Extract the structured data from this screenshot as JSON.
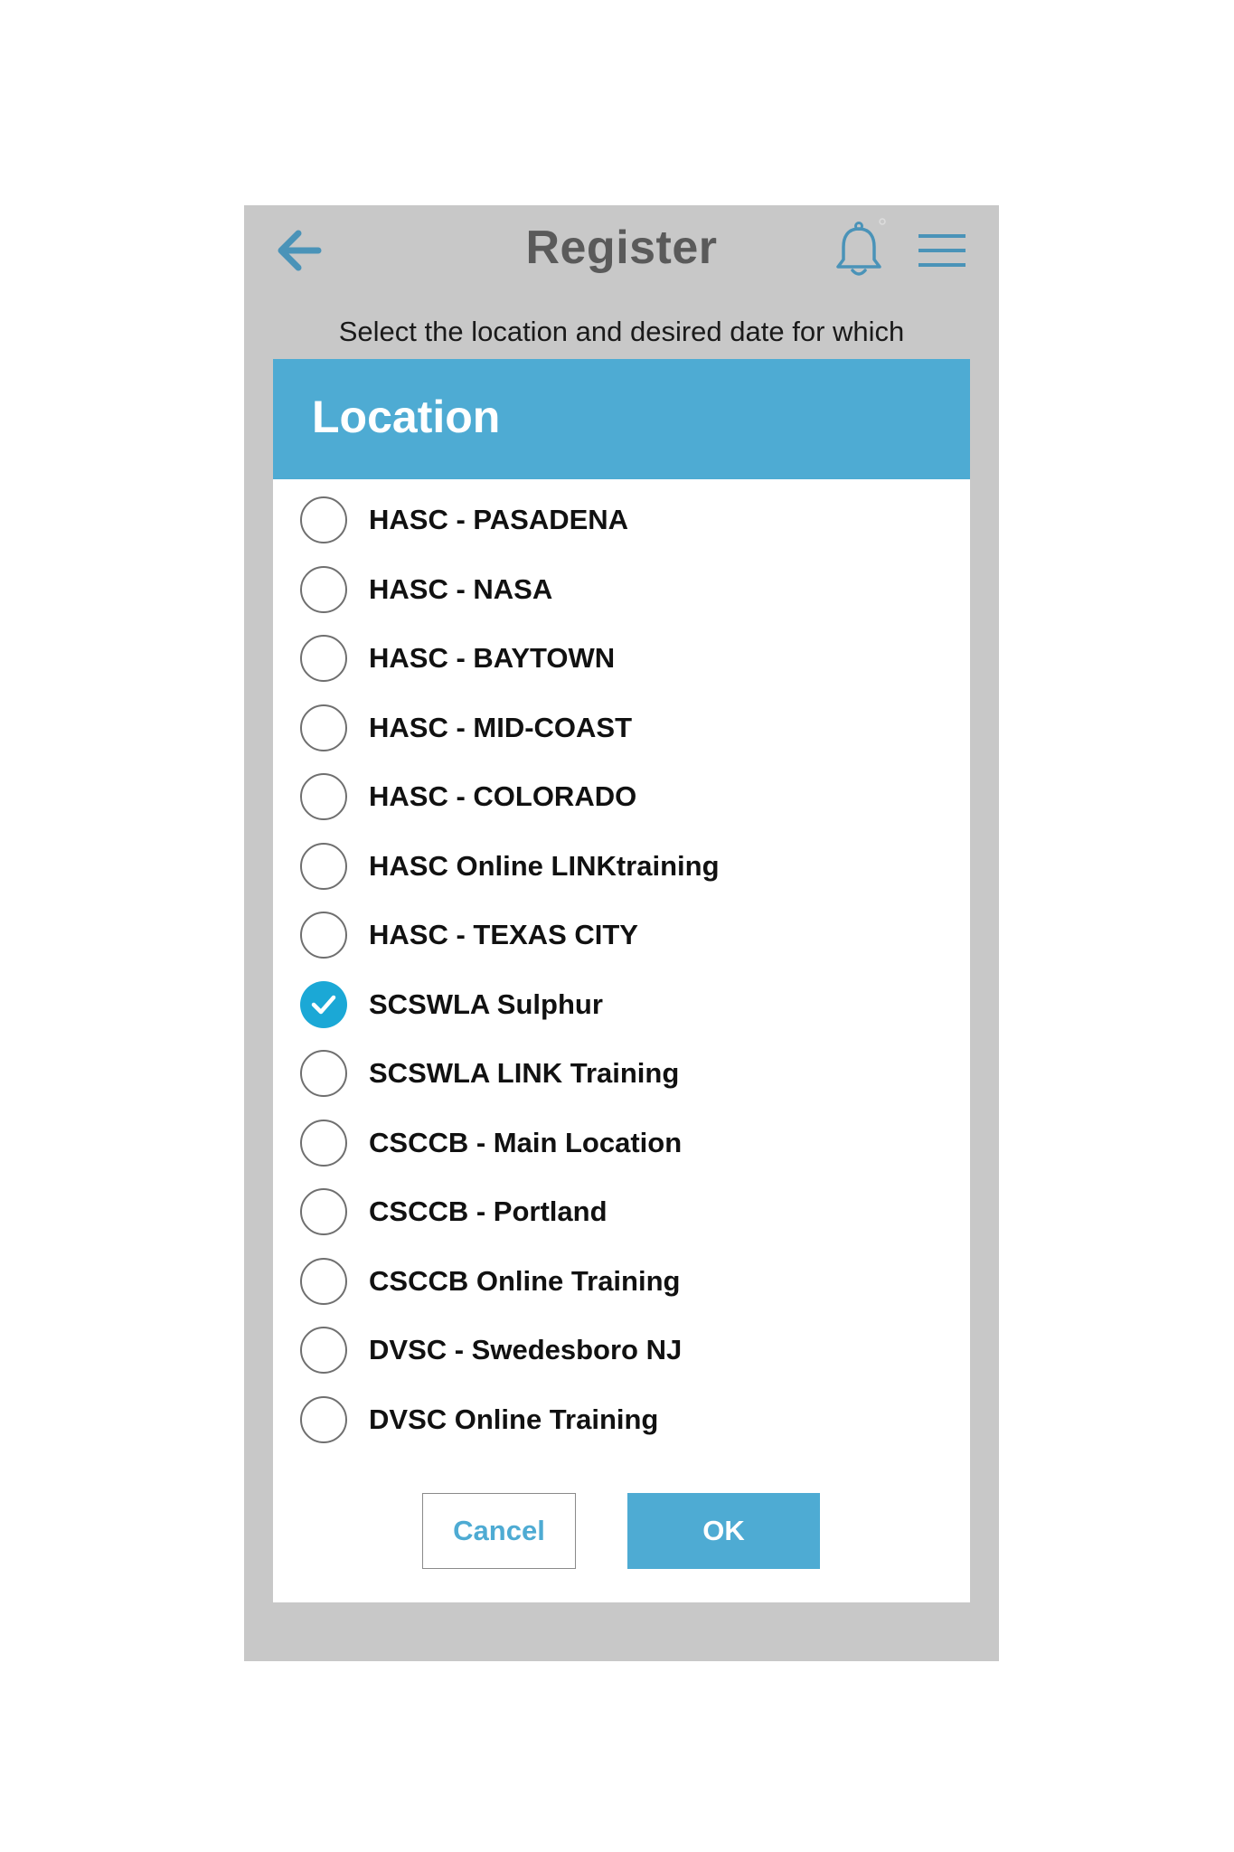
{
  "header": {
    "title": "Register",
    "back_icon": "arrow-left-icon",
    "bell_icon": "bell-icon",
    "menu_icon": "hamburger-menu-icon"
  },
  "subtitle": "Select the location and desired date for which",
  "dialog": {
    "title": "Location",
    "options": [
      {
        "label": "HASC - PASADENA",
        "selected": false
      },
      {
        "label": "HASC - NASA",
        "selected": false
      },
      {
        "label": "HASC - BAYTOWN",
        "selected": false
      },
      {
        "label": "HASC - MID-COAST",
        "selected": false
      },
      {
        "label": "HASC - COLORADO",
        "selected": false
      },
      {
        "label": "HASC Online LINKtraining",
        "selected": false
      },
      {
        "label": "HASC - TEXAS CITY",
        "selected": false
      },
      {
        "label": "SCSWLA Sulphur",
        "selected": true
      },
      {
        "label": "SCSWLA LINK Training",
        "selected": false
      },
      {
        "label": "CSCCB - Main Location",
        "selected": false
      },
      {
        "label": "CSCCB - Portland",
        "selected": false
      },
      {
        "label": "CSCCB Online Training",
        "selected": false
      },
      {
        "label": "DVSC - Swedesboro NJ",
        "selected": false
      },
      {
        "label": "DVSC Online Training",
        "selected": false
      }
    ],
    "cancel_label": "Cancel",
    "ok_label": "OK"
  },
  "colors": {
    "accent": "#4eabd3",
    "checked": "#1ba8d6",
    "background": "#c8c8c8",
    "title_text": "#5a5a5a"
  }
}
